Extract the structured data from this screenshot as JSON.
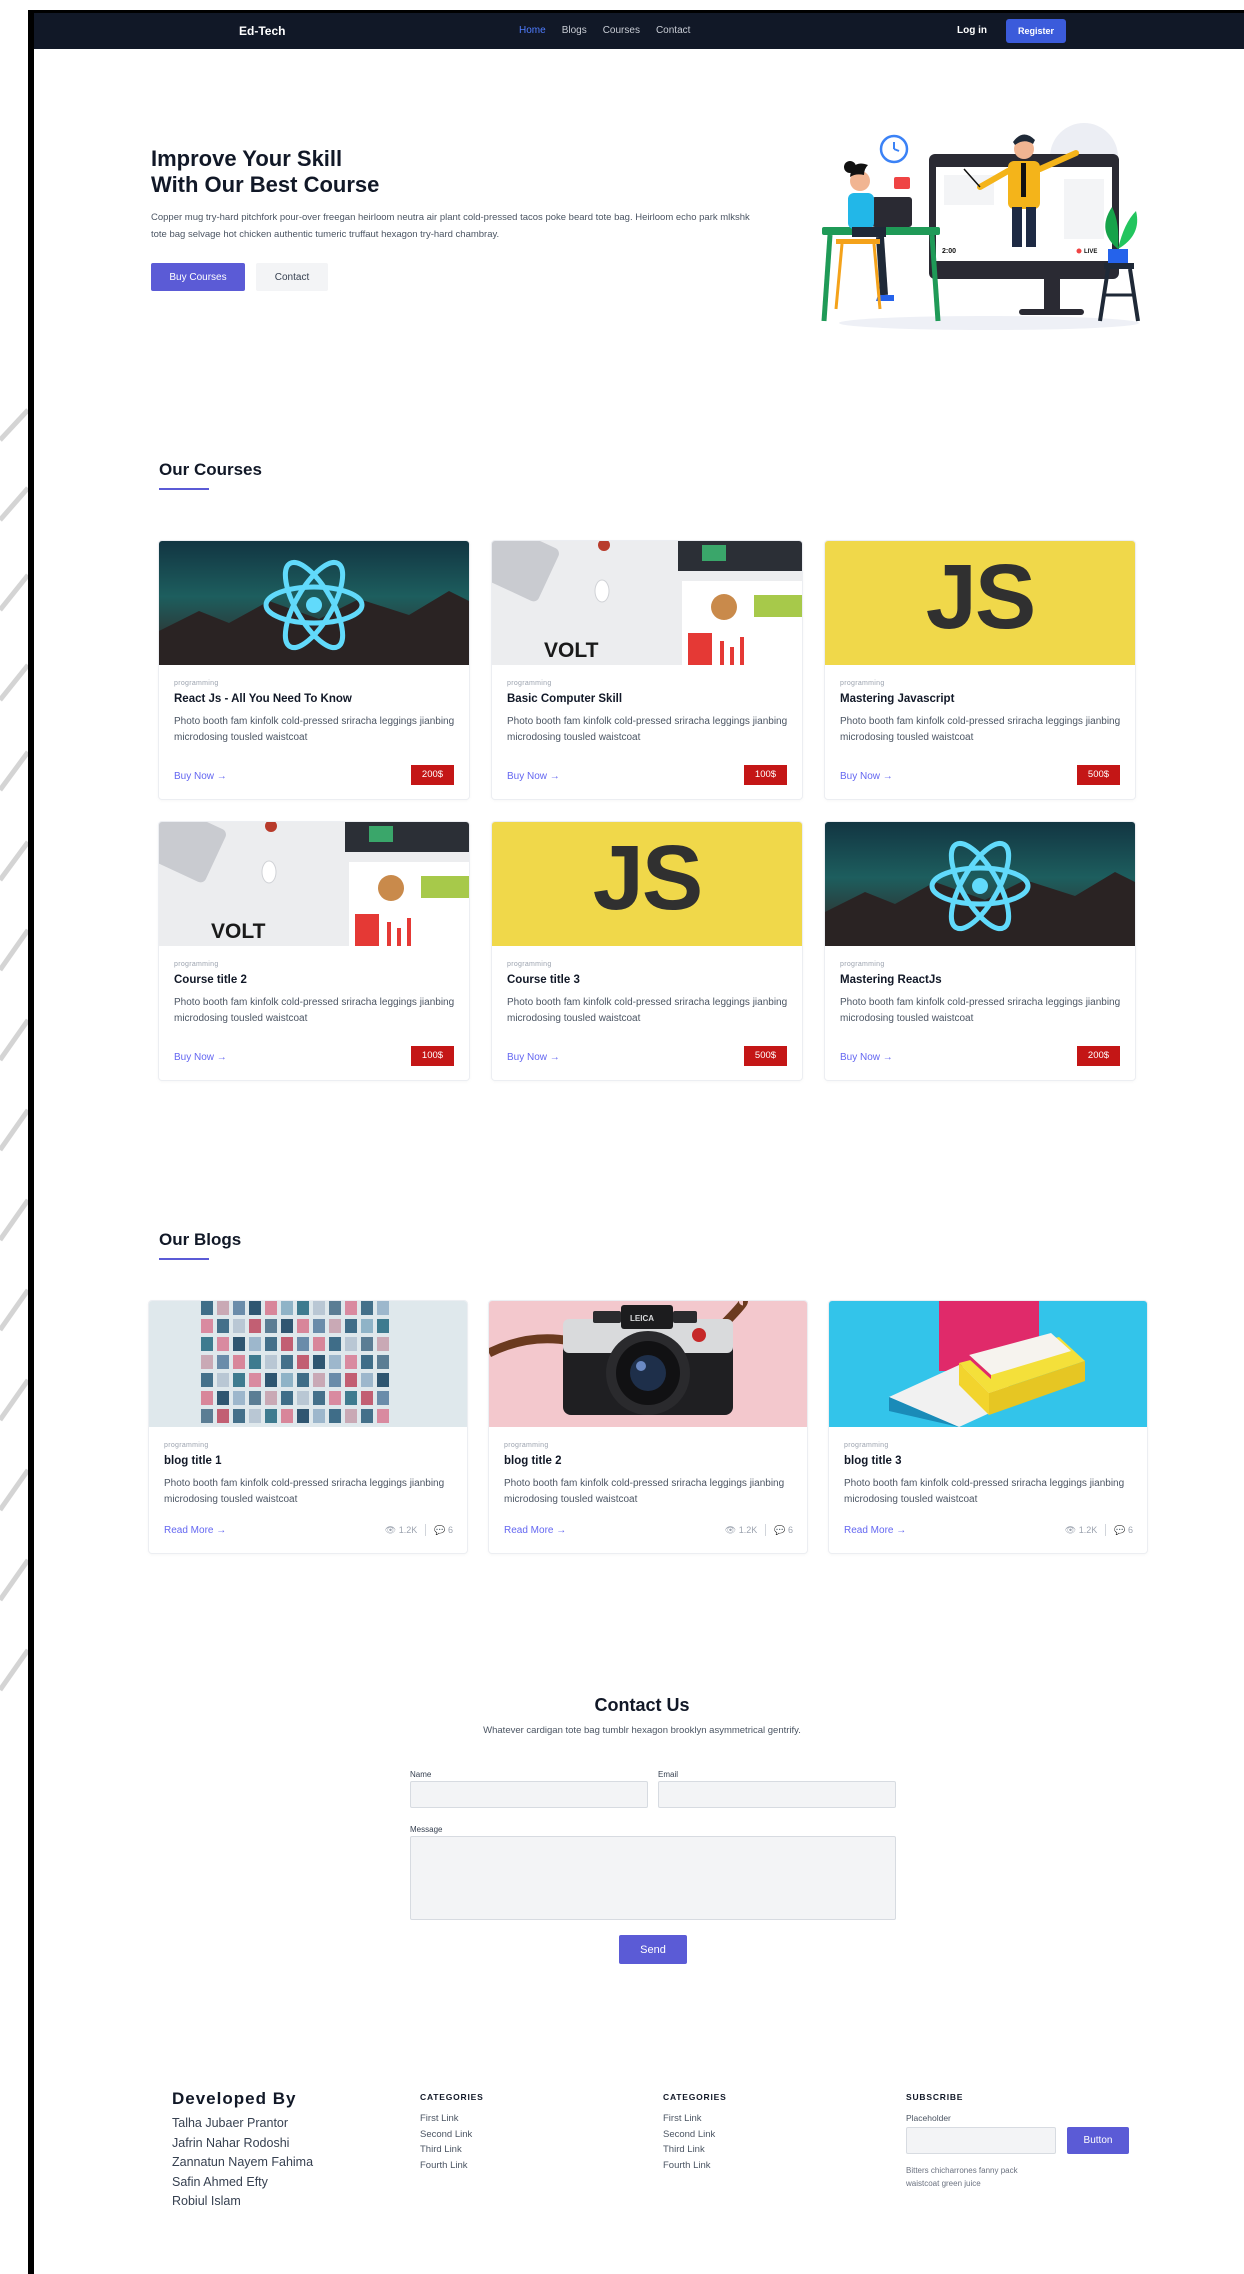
{
  "nav": {
    "brand": "Ed-Tech",
    "links": [
      "Home",
      "Blogs",
      "Courses",
      "Contact"
    ],
    "login": "Log in",
    "register": "Register"
  },
  "hero": {
    "title_line1": "Improve Your Skill",
    "title_line2": "With Our Best Course",
    "text": "Copper mug try-hard pitchfork pour-over freegan heirloom neutra air plant cold-pressed tacos poke beard tote bag. Heirloom echo park mlkshk tote bag selvage hot chicken authentic tumeric truffaut hexagon try-hard chambray.",
    "buy_button": "Buy Courses",
    "contact_button": "Contact",
    "screen_badge_left": "2:00",
    "screen_badge_right": "LIVE"
  },
  "courses": {
    "title": "Our Courses",
    "buy_label": "Buy Now",
    "items": [
      {
        "category": "programming",
        "title": "React Js - All You Need To Know",
        "desc": "Photo booth fam kinfolk cold-pressed sriracha leggings jianbing microdosing tousled waistcoat",
        "price": "200$",
        "image": "react"
      },
      {
        "category": "programming",
        "title": "Basic Computer Skill",
        "desc": "Photo booth fam kinfolk cold-pressed sriracha leggings jianbing microdosing tousled waistcoat",
        "price": "100$",
        "image": "volt"
      },
      {
        "category": "programming",
        "title": "Mastering Javascript",
        "desc": "Photo booth fam kinfolk cold-pressed sriracha leggings jianbing microdosing tousled waistcoat",
        "price": "500$",
        "image": "js"
      },
      {
        "category": "programming",
        "title": "Course title 2",
        "desc": "Photo booth fam kinfolk cold-pressed sriracha leggings jianbing microdosing tousled waistcoat",
        "price": "100$",
        "image": "volt"
      },
      {
        "category": "programming",
        "title": "Course title 3",
        "desc": "Photo booth fam kinfolk cold-pressed sriracha leggings jianbing microdosing tousled waistcoat",
        "price": "500$",
        "image": "js"
      },
      {
        "category": "programming",
        "title": "Mastering ReactJs",
        "desc": "Photo booth fam kinfolk cold-pressed sriracha leggings jianbing microdosing tousled waistcoat",
        "price": "200$",
        "image": "react"
      }
    ],
    "js_logo_text": "JS",
    "volt_logo_text": "VOLT"
  },
  "blogs": {
    "title": "Our Blogs",
    "read_label": "Read More",
    "items": [
      {
        "category": "programming",
        "title": "blog title 1",
        "desc": "Photo booth fam kinfolk cold-pressed sriracha leggings jianbing microdosing tousled waistcoat",
        "views": "1.2K",
        "comments": "6"
      },
      {
        "category": "programming",
        "title": "blog title 2",
        "desc": "Photo booth fam kinfolk cold-pressed sriracha leggings jianbing microdosing tousled waistcoat",
        "views": "1.2K",
        "comments": "6"
      },
      {
        "category": "programming",
        "title": "blog title 3",
        "desc": "Photo booth fam kinfolk cold-pressed sriracha leggings jianbing microdosing tousled waistcoat",
        "views": "1.2K",
        "comments": "6"
      }
    ],
    "camera_brand": "LEICA"
  },
  "contact": {
    "title": "Contact Us",
    "subtitle": "Whatever cardigan tote bag tumblr hexagon brooklyn asymmetrical gentrify.",
    "name_label": "Name",
    "email_label": "Email",
    "message_label": "Message",
    "send": "Send"
  },
  "footer": {
    "dev_title": "Developed By",
    "developers": [
      "Talha Jubaer Prantor",
      "Jafrin Nahar Rodoshi",
      "Zannatun Nayem Fahima",
      "Safin Ahmed Efty",
      "Robiul Islam"
    ],
    "col1_title": "CATEGORIES",
    "col1_links": [
      "First Link",
      "Second Link",
      "Third Link",
      "Fourth Link"
    ],
    "col2_title": "CATEGORIES",
    "col2_links": [
      "First Link",
      "Second Link",
      "Third Link",
      "Fourth Link"
    ],
    "subscribe_title": "SUBSCRIBE",
    "subscribe_label": "Placeholder",
    "subscribe_button": "Button",
    "subscribe_text": "Bitters chicharrones fanny pack waistcoat green juice"
  },
  "colors": {
    "nav_bg": "#111827",
    "accent": "#5b5bd6",
    "price_badge": "#c41616",
    "register_btn": "#3b5bdb"
  }
}
